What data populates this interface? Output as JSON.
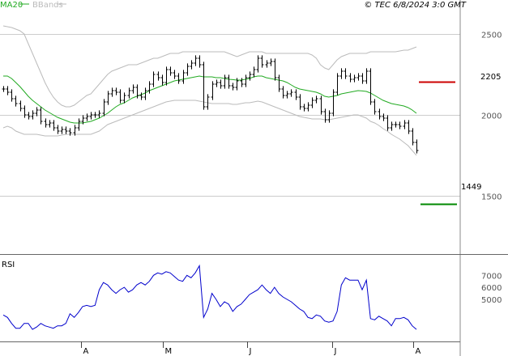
{
  "header": {
    "legend": [
      {
        "label": "MA20",
        "color": "#22aa22"
      },
      {
        "label": "BBands",
        "color": "#bbbbbb"
      }
    ],
    "source": "© TEC 6/8/2024 3:0 GMT"
  },
  "chart_data": [
    {
      "type": "ohlc",
      "title": "",
      "ylim": [
        1150,
        2650
      ],
      "y_ticks": [
        "2500",
        "2000",
        "1500"
      ],
      "x_ticks": [
        "A",
        "M",
        "J",
        "J",
        "A"
      ],
      "grid": true,
      "closes": [
        2160,
        2140,
        2100,
        2070,
        2040,
        2000,
        1990,
        2010,
        2030,
        1960,
        1940,
        1950,
        1920,
        1900,
        1910,
        1900,
        1890,
        1920,
        1960,
        1980,
        1990,
        2000,
        2000,
        2010,
        2080,
        2130,
        2150,
        2140,
        2090,
        2120,
        2150,
        2170,
        2120,
        2110,
        2150,
        2190,
        2250,
        2230,
        2200,
        2280,
        2260,
        2240,
        2210,
        2260,
        2300,
        2320,
        2350,
        2310,
        2050,
        2110,
        2190,
        2200,
        2180,
        2230,
        2180,
        2170,
        2210,
        2190,
        2230,
        2250,
        2280,
        2350,
        2310,
        2320,
        2330,
        2230,
        2160,
        2120,
        2130,
        2140,
        2110,
        2050,
        2040,
        2060,
        2090,
        2100,
        2020,
        1970,
        2010,
        2140,
        2240,
        2270,
        2240,
        2220,
        2230,
        2240,
        2210,
        2270,
        2080,
        2020,
        1990,
        1980,
        1920,
        1940,
        1940,
        1930,
        1950,
        1900,
        1830,
        1780
      ],
      "series": [
        {
          "name": "MA20",
          "color": "#22aa22",
          "values": [
            2240,
            2240,
            2225,
            2200,
            2175,
            2145,
            2115,
            2090,
            2070,
            2050,
            2030,
            2015,
            2000,
            1985,
            1975,
            1965,
            1955,
            1950,
            1950,
            1950,
            1955,
            1960,
            1970,
            1980,
            1995,
            2010,
            2030,
            2050,
            2065,
            2075,
            2090,
            2105,
            2115,
            2125,
            2135,
            2150,
            2160,
            2170,
            2180,
            2190,
            2200,
            2210,
            2215,
            2220,
            2225,
            2230,
            2235,
            2240,
            2235,
            2235,
            2235,
            2230,
            2230,
            2225,
            2220,
            2218,
            2215,
            2215,
            2220,
            2225,
            2235,
            2240,
            2240,
            2230,
            2225,
            2220,
            2215,
            2210,
            2200,
            2185,
            2170,
            2160,
            2155,
            2150,
            2145,
            2140,
            2130,
            2115,
            2110,
            2115,
            2120,
            2130,
            2135,
            2140,
            2145,
            2150,
            2148,
            2145,
            2135,
            2120,
            2105,
            2090,
            2080,
            2070,
            2065,
            2060,
            2055,
            2045,
            2030,
            2010
          ]
        },
        {
          "name": "BBands",
          "color": "#bbbbbb",
          "values": [
            2550,
            2545,
            2540,
            2530,
            2520,
            2500,
            2440,
            2380,
            2320,
            2260,
            2200,
            2150,
            2110,
            2080,
            2060,
            2050,
            2050,
            2060,
            2080,
            2100,
            2120,
            2130,
            2160,
            2190,
            2220,
            2250,
            2270,
            2280,
            2290,
            2300,
            2310,
            2310,
            2310,
            2320,
            2330,
            2340,
            2350,
            2350,
            2360,
            2370,
            2380,
            2380,
            2380,
            2390,
            2390,
            2390,
            2390,
            2390,
            2390,
            2390,
            2390,
            2390,
            2390,
            2390,
            2380,
            2370,
            2360,
            2370,
            2380,
            2390,
            2390,
            2390,
            2390,
            2380,
            2380,
            2380,
            2380,
            2380,
            2380,
            2380,
            2380,
            2380,
            2380,
            2380,
            2370,
            2350,
            2310,
            2290,
            2280,
            2310,
            2340,
            2360,
            2370,
            2380,
            2380,
            2380,
            2380,
            2380,
            2390,
            2390,
            2390,
            2390,
            2390,
            2390,
            2390,
            2395,
            2400,
            2400,
            2410,
            2420
          ]
        },
        {
          "name": "BBands",
          "color": "#bbbbbb",
          "values": [
            1920,
            1930,
            1920,
            1900,
            1890,
            1880,
            1880,
            1880,
            1880,
            1875,
            1870,
            1870,
            1870,
            1870,
            1875,
            1880,
            1880,
            1880,
            1880,
            1880,
            1880,
            1880,
            1890,
            1900,
            1920,
            1940,
            1950,
            1960,
            1970,
            1980,
            1990,
            2000,
            2010,
            2020,
            2030,
            2040,
            2050,
            2060,
            2070,
            2080,
            2085,
            2090,
            2090,
            2090,
            2090,
            2090,
            2090,
            2085,
            2080,
            2075,
            2070,
            2070,
            2070,
            2070,
            2070,
            2065,
            2065,
            2070,
            2075,
            2075,
            2080,
            2085,
            2080,
            2070,
            2060,
            2050,
            2040,
            2030,
            2020,
            2010,
            2000,
            1990,
            1985,
            1980,
            1975,
            1975,
            1975,
            1970,
            1970,
            1975,
            1980,
            1985,
            1990,
            1995,
            2000,
            2000,
            1990,
            1980,
            1960,
            1950,
            1935,
            1915,
            1900,
            1880,
            1865,
            1850,
            1830,
            1810,
            1780,
            1750
          ]
        }
      ],
      "levels": [
        {
          "label": "2205",
          "value": 2205,
          "color": "#cc0000"
        },
        {
          "label": "1449",
          "value": 1449,
          "color": "#008800"
        }
      ]
    },
    {
      "type": "line",
      "title": "RSI",
      "ylim": [
        15,
        85
      ],
      "y_ticks": [
        "7000",
        "6000",
        "5000"
      ],
      "grid": false,
      "series": [
        {
          "name": "",
          "color": "#0000cc",
          "values": [
            37,
            35,
            30,
            26,
            26,
            30,
            30,
            25,
            27,
            30,
            28,
            27,
            26,
            28,
            28,
            30,
            38,
            35,
            39,
            44,
            45,
            44,
            45,
            58,
            64,
            62,
            58,
            55,
            58,
            60,
            56,
            58,
            62,
            64,
            62,
            65,
            70,
            72,
            71,
            73,
            72,
            69,
            66,
            65,
            70,
            68,
            72,
            78,
            35,
            42,
            55,
            50,
            44,
            48,
            46,
            40,
            44,
            46,
            50,
            54,
            56,
            58,
            62,
            58,
            55,
            60,
            55,
            52,
            50,
            48,
            45,
            42,
            40,
            35,
            34,
            37,
            36,
            32,
            31,
            32,
            40,
            62,
            68,
            66,
            66,
            66,
            58,
            66,
            34,
            33,
            36,
            34,
            32,
            28,
            34,
            34,
            35,
            33,
            28,
            25
          ]
        }
      ]
    }
  ]
}
